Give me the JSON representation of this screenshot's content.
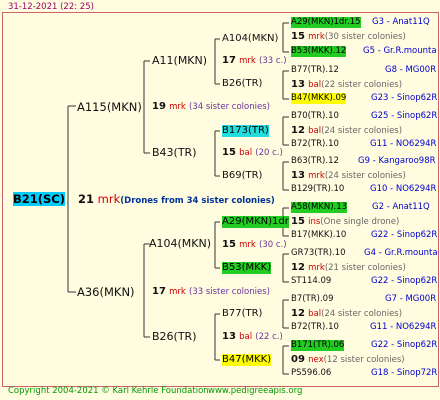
{
  "date": "31-12-2021 (22: 25)",
  "root": {
    "name": "B21(SC)",
    "count": "21",
    "mrk": "mrk",
    "note": "(Drones from 34 sister colonies)"
  },
  "gen1": [
    {
      "name": "A115(MKN)",
      "count": "19",
      "mrk": "mrk",
      "sub": "(34 sister colonies)"
    },
    {
      "name": "A36(MKN)",
      "count": "17",
      "mrk": "mrk",
      "sub": "(33 sister colonies)"
    }
  ],
  "gen2": [
    {
      "name": "A11(MKN)",
      "count": "17",
      "mrk": "mrk",
      "sub": "(33 c.)"
    },
    {
      "name": "B43(TR)",
      "count": "15",
      "mrk": "bal",
      "sub": "(20 c.)"
    },
    {
      "name": "A104(MKN)",
      "count": "15",
      "mrk": "mrk",
      "sub": "(30 c.)"
    },
    {
      "name": "B26(TR)",
      "count": "13",
      "mrk": "bal",
      "sub": "(22 c.)"
    }
  ],
  "gen3": [
    {
      "name": "A104(MKN)",
      "count": "15",
      "mrk": "mrk",
      "sub": "(30 sister colonies)"
    },
    {
      "name": "B26(TR)",
      "count": "13",
      "mrk": "bal",
      "sub": "(22 sister colonies)"
    },
    {
      "name": "B173(TR)",
      "count": "12",
      "mrk": "bal",
      "sub": "(24 sister colonies)"
    },
    {
      "name": "B69(TR)",
      "count": "13",
      "mrk": "mrk",
      "sub": "(24 sister colonies)"
    },
    {
      "name": "A29(MKN)1dr",
      "count": "15",
      "mrk": "ins",
      "sub": "(One single drone)"
    },
    {
      "name": "B53(MKK)",
      "count": "12",
      "mrk": "mrk",
      "sub": "(21 sister colonies)"
    },
    {
      "name": "B77(TR)",
      "count": "12",
      "mrk": "bal",
      "sub": "(24 sister colonies)"
    },
    {
      "name": "B47(MKK)",
      "count": "09",
      "mrk": "nex",
      "sub": "(12 sister colonies)"
    }
  ],
  "gen4": [
    {
      "name": "A29(MKN)1dr.15",
      "code": "G3 - Anat11Q"
    },
    {
      "name": "B53(MKK).12",
      "code": "G5 - Gr.R.mounta"
    },
    {
      "name": "B77(TR).12",
      "code": "G8 - MG00R"
    },
    {
      "name": "B47(MKK).09",
      "code": "G23 - Sinop62R"
    },
    {
      "name": "B70(TR).10",
      "code": "G25 - Sinop62R"
    },
    {
      "name": "B72(TR).10",
      "code": "G11 - NO6294R"
    },
    {
      "name": "B63(TR).12",
      "code": "G9 - Kangaroo98R"
    },
    {
      "name": "B129(TR).10",
      "code": "G10 - NO6294R"
    },
    {
      "name": "A58(MKN).13",
      "code": "G2 - Anat11Q"
    },
    {
      "name": "B17(MKK).10",
      "code": "G22 - Sinop62R"
    },
    {
      "name": "GR73(TR).10",
      "code": "G4 - Gr.R.mounta"
    },
    {
      "name": "ST114.09",
      "code": "G22 - Sinop62R"
    },
    {
      "name": "B7(TR).09",
      "code": "G7 - MG00R"
    },
    {
      "name": "B72(TR).10",
      "code": "G11 - NO6294R"
    },
    {
      "name": "B171(TR).06",
      "code": "G22 - Sinop62R"
    },
    {
      "name": "PS596.06",
      "code": "G18 - Sinop72R"
    }
  ],
  "footer": {
    "copyright": "Copyright 2004-2021 © Karl Kehrle Foundation",
    "site": "www.pedigreeapis.org"
  }
}
